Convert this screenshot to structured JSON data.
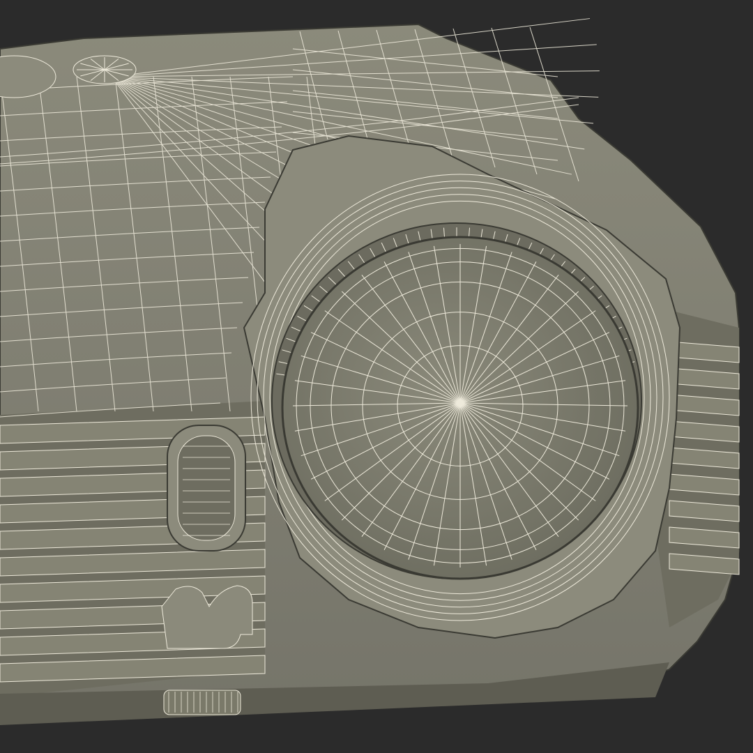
{
  "scene": {
    "subject": "projector-wireframe-render",
    "colors": {
      "background": "#2b2b2b",
      "body": "#7e7d6e",
      "body_dark": "#6e6d60",
      "body_light": "#8c8b7c",
      "wire": "#eeeadb",
      "edge": "#3a3a33"
    }
  }
}
